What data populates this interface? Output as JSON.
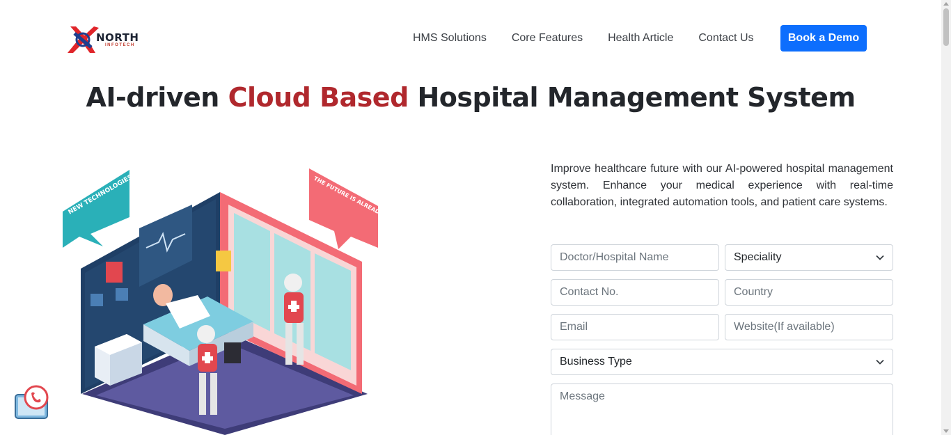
{
  "brand": {
    "name": "NORTH",
    "sub": "INFOTECH",
    "colors": {
      "red": "#e0252a",
      "blue": "#1e3f8f",
      "dark": "#1d2433"
    }
  },
  "nav": {
    "items": [
      "HMS Solutions",
      "Core Features",
      "Health Article",
      "Contact Us"
    ],
    "cta": "Book a Demo",
    "cta_color": "#0d6efd"
  },
  "hero": {
    "title_part1": "AI-driven",
    "title_accent": "Cloud Based",
    "title_part2": "Hospital Management System",
    "accent_color": "#b0282d"
  },
  "illustration": {
    "banner_left": "NEW TECHNOLOGIES",
    "banner_right": "THE FUTURE IS ALREADY HERE"
  },
  "form": {
    "intro": "Improve healthcare future with our AI-powered hospital management system. Enhance your medical experience with real-time collaboration, integrated automation tools, and patient care systems.",
    "name_placeholder": "Doctor/Hospital Name",
    "speciality_value": "Speciality",
    "contact_placeholder": "Contact No.",
    "country_placeholder": "Country",
    "email_placeholder": "Email",
    "website_placeholder": "Website(If available)",
    "business_value": "Business Type",
    "message_placeholder": "Message"
  },
  "icons": [
    "chevron-down-icon",
    "phone-icon"
  ]
}
